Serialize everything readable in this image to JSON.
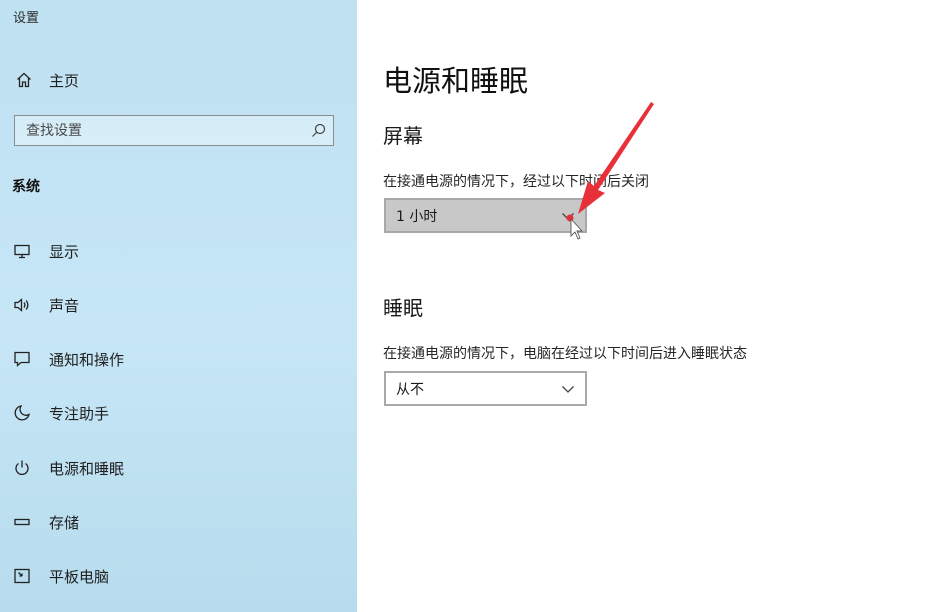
{
  "window": {
    "title": "设置"
  },
  "sidebar": {
    "home_label": "主页",
    "search_placeholder": "查找设置",
    "section_title": "系统",
    "items": [
      {
        "label": "显示",
        "icon": "monitor-icon"
      },
      {
        "label": "声音",
        "icon": "speaker-icon"
      },
      {
        "label": "通知和操作",
        "icon": "notification-icon"
      },
      {
        "label": "专注助手",
        "icon": "moon-icon"
      },
      {
        "label": "电源和睡眠",
        "icon": "power-icon"
      },
      {
        "label": "存储",
        "icon": "storage-icon"
      },
      {
        "label": "平板电脑",
        "icon": "tablet-icon"
      }
    ]
  },
  "main": {
    "page_title": "电源和睡眠",
    "screen": {
      "title": "屏幕",
      "description": "在接通电源的情况下，经过以下时间后关闭",
      "selected": "1 小时"
    },
    "sleep": {
      "title": "睡眠",
      "description": "在接通电源的情况下，电脑在经过以下时间后进入睡眠状态",
      "selected": "从不"
    }
  },
  "colors": {
    "sidebar_bg": "#c2e4f5",
    "annotation_arrow": "#e8303a"
  }
}
